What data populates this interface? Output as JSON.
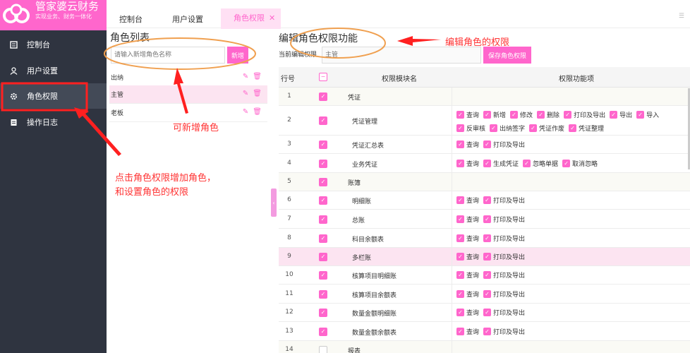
{
  "sidebar": {
    "logo_title": "管家婆云财务",
    "logo_sub": "实现业务、财务一体化",
    "items": [
      {
        "label": "控制台",
        "icon": "document-icon"
      },
      {
        "label": "用户设置",
        "icon": "user-icon"
      },
      {
        "label": "角色权限",
        "icon": "gear-icon"
      },
      {
        "label": "操作日志",
        "icon": "log-icon"
      }
    ]
  },
  "tabs": [
    {
      "label": "控制台"
    },
    {
      "label": "用户设置"
    },
    {
      "label": "角色权限",
      "close": "✕"
    }
  ],
  "roles": {
    "title": "角色列表",
    "placeholder": "请输入新增角色名称",
    "add_label": "新增",
    "items": [
      {
        "name": "出纳"
      },
      {
        "name": "主管"
      },
      {
        "name": "老板"
      }
    ]
  },
  "perm": {
    "title": "编辑角色权限功能",
    "current_label": "当前编辑权限",
    "current_value": "主管",
    "save_label": "保存角色权限",
    "headers": {
      "num": "行号",
      "module": "权限模块名",
      "funcs": "权限功能项"
    },
    "rows": [
      {
        "num": "1",
        "name": "凭证",
        "group": true,
        "funcs": []
      },
      {
        "num": "2",
        "name": "凭证管理",
        "funcs": [
          "查询",
          "新增",
          "修改",
          "删除",
          "打印及导出",
          "导出",
          "导入"
        ],
        "funcs2": [
          "反审核",
          "出纳签字",
          "凭证作废",
          "凭证整理"
        ]
      },
      {
        "num": "3",
        "name": "凭证汇总表",
        "funcs": [
          "查询",
          "打印及导出"
        ]
      },
      {
        "num": "4",
        "name": "业务凭证",
        "funcs": [
          "查询",
          "生成凭证",
          "忽略单据",
          "取消忽略"
        ]
      },
      {
        "num": "5",
        "name": "账簿",
        "group": true,
        "funcs": []
      },
      {
        "num": "6",
        "name": "明细账",
        "funcs": [
          "查询",
          "打印及导出"
        ]
      },
      {
        "num": "7",
        "name": "总账",
        "funcs": [
          "查询",
          "打印及导出"
        ]
      },
      {
        "num": "8",
        "name": "科目余额表",
        "funcs": [
          "查询",
          "打印及导出"
        ]
      },
      {
        "num": "9",
        "name": "多栏账",
        "funcs": [
          "查询",
          "打印及导出"
        ],
        "hl": true
      },
      {
        "num": "10",
        "name": "核算项目明细账",
        "funcs": [
          "查询",
          "打印及导出"
        ]
      },
      {
        "num": "11",
        "name": "核算项目余额表",
        "funcs": [
          "查询",
          "打印及导出"
        ]
      },
      {
        "num": "12",
        "name": "数量金额明细账",
        "funcs": [
          "查询",
          "打印及导出"
        ]
      },
      {
        "num": "13",
        "name": "数量金额余额表",
        "funcs": [
          "查询",
          "打印及导出"
        ]
      },
      {
        "num": "14",
        "name": "报表",
        "group": true,
        "unchecked": true,
        "funcs": []
      }
    ]
  },
  "annotations": {
    "edit_perm": "编辑角色的权限",
    "add_role": "可新增角色",
    "click_line1": "点击角色权限增加角色，",
    "click_line2": "和设置角色的权限"
  },
  "colors": {
    "accent": "#ff66cc",
    "sidebar": "#2f3440",
    "annotation": "#ff3333",
    "highlight_row": "#fce4f1"
  }
}
